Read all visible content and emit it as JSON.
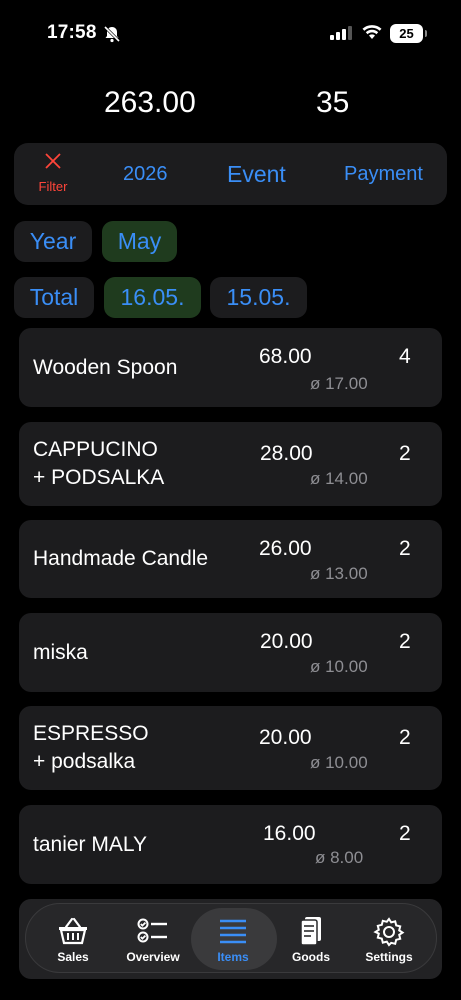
{
  "status_bar": {
    "time": "17:58",
    "battery": "25"
  },
  "summary": {
    "total_amount": "263.00",
    "total_count": "35"
  },
  "filter_bar": {
    "filter_label": "Filter",
    "year": "2026",
    "event": "Event",
    "payment": "Payment"
  },
  "period_chips": {
    "year": "Year",
    "month": "May"
  },
  "day_chips": {
    "total": "Total",
    "day1": "16.05.",
    "day2": "15.05."
  },
  "items": [
    {
      "name_line1": "Wooden Spoon",
      "name_line2": "",
      "amount": "68.00",
      "avg": "ø  17.00",
      "qty": "4"
    },
    {
      "name_line1": "CAPPUCINO",
      "name_line2": "+ PODSALKA",
      "amount": "28.00",
      "avg": "ø  14.00",
      "qty": "2"
    },
    {
      "name_line1": " Handmade Candle",
      "name_line2": "",
      "amount": "26.00",
      "avg": "ø  13.00",
      "qty": "2"
    },
    {
      "name_line1": "miska",
      "name_line2": "",
      "amount": "20.00",
      "avg": "ø  10.00",
      "qty": "2"
    },
    {
      "name_line1": "ESPRESSO",
      "name_line2": "+ podsalka",
      "amount": "20.00",
      "avg": "ø  10.00",
      "qty": "2"
    },
    {
      "name_line1": "tanier MALY",
      "name_line2": "",
      "amount": "16.00",
      "avg": "ø  8.00",
      "qty": "2"
    }
  ],
  "tabs": {
    "sales": "Sales",
    "overview": "Overview",
    "items": "Items",
    "goods": "Goods",
    "settings": "Settings"
  },
  "colors": {
    "accent": "#3a8ef6",
    "danger": "#ff453a",
    "card": "#1c1c1e",
    "active_chip": "#1f3b1e"
  }
}
